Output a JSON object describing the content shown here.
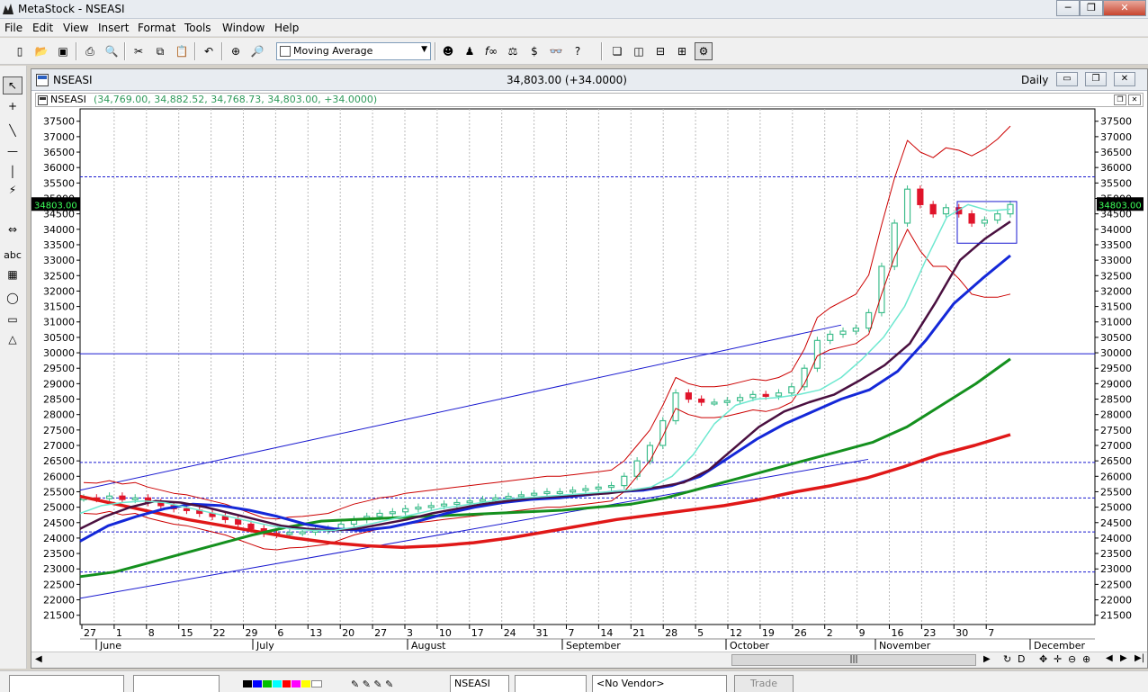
{
  "window": {
    "title": "MetaStock - NSEASI"
  },
  "menu": [
    "File",
    "Edit",
    "View",
    "Insert",
    "Format",
    "Tools",
    "Window",
    "Help"
  ],
  "toolbar": {
    "indicator_select": "Moving Average"
  },
  "chart_window": {
    "symbol": "NSEASI",
    "price_summary": "34,803.00 (+34.0000)",
    "periodicity": "Daily",
    "pane_title_symbol": "NSEASI",
    "pane_title_ohlc": "(34,769.00, 34,882.52, 34,768.73, 34,803.00, +34.0000)",
    "last_price_tag": "34803.00"
  },
  "statusbar": {
    "symbol": "NSEASI",
    "vendor": "<No Vendor>",
    "trade": "Trade"
  },
  "colors": {
    "up_candle": "#3ebd8c",
    "down_candle": "#e0142a",
    "ma_light": "#6ee8d0",
    "ma_maroon": "#4a1040",
    "ma_blue": "#1428d8",
    "ma_green": "#14901e",
    "ma_red": "#e01818",
    "band": "#cc0000",
    "line": "#1a1ad0"
  },
  "chart_data": {
    "type": "candlestick",
    "y_ticks": [
      21500,
      22000,
      22500,
      23000,
      23500,
      24000,
      24500,
      25000,
      25500,
      26000,
      26500,
      27000,
      27500,
      28000,
      28500,
      29000,
      29500,
      30000,
      30500,
      31000,
      31500,
      32000,
      32500,
      33000,
      33500,
      34000,
      34500,
      35000,
      35500,
      36000,
      36500,
      37000,
      37500
    ],
    "ylim": [
      21200,
      37900
    ],
    "x_day_labels": [
      "27",
      "1",
      "8",
      "15",
      "22",
      "29",
      "6",
      "13",
      "20",
      "27",
      "3",
      "10",
      "17",
      "24",
      "31",
      "7",
      "14",
      "21",
      "28",
      "5",
      "12",
      "19",
      "26",
      "2",
      "9",
      "16",
      "23",
      "30",
      "7"
    ],
    "x_month_labels": [
      "June",
      "July",
      "August",
      "September",
      "October",
      "November",
      "December"
    ],
    "horizontal_lines": [
      35700,
      29970,
      26450,
      25300,
      24200,
      22900
    ],
    "solid_horizontal": 29970,
    "close_series": [
      25300,
      25280,
      25360,
      25250,
      25300,
      25150,
      25050,
      24950,
      24900,
      24800,
      24700,
      24600,
      24450,
      24300,
      24150,
      24120,
      24180,
      24200,
      24250,
      24300,
      24450,
      24600,
      24700,
      24800,
      24850,
      24950,
      25000,
      25050,
      25100,
      25150,
      25200,
      25250,
      25300,
      25350,
      25400,
      25450,
      25500,
      25500,
      25550,
      25600,
      25650,
      25700,
      26000,
      26500,
      27000,
      27800,
      28700,
      28500,
      28400,
      28400,
      28450,
      28550,
      28650,
      28600,
      28700,
      28900,
      29500,
      30400,
      30600,
      30700,
      30800,
      31300,
      32800,
      34200,
      35300,
      34800,
      34500,
      34700,
      34500,
      34200,
      34300,
      34500,
      34803
    ],
    "ma_light": [
      24800,
      25050,
      25150,
      25200,
      25150,
      25000,
      24850,
      24700,
      24550,
      24400,
      24300,
      24250,
      24250,
      24350,
      24500,
      24650,
      24800,
      24950,
      25050,
      25150,
      25250,
      25300,
      25350,
      25400,
      25450,
      25500,
      25550,
      25650,
      26000,
      26700,
      27700,
      28300,
      28500,
      28550,
      28650,
      28800,
      29200,
      29800,
      30500,
      31500,
      33000,
      34400,
      34800,
      34600,
      34650
    ],
    "ma_maroon": [
      24300,
      24700,
      25000,
      25200,
      25150,
      25000,
      24800,
      24600,
      24400,
      24300,
      24250,
      24300,
      24450,
      24600,
      24800,
      24950,
      25100,
      25200,
      25300,
      25350,
      25400,
      25450,
      25550,
      25650,
      25800,
      26200,
      26900,
      27600,
      28100,
      28400,
      28650,
      29100,
      29600,
      30300,
      31600,
      33000,
      33700,
      34250
    ],
    "ma_blue": [
      23900,
      24400,
      24700,
      24950,
      25100,
      25050,
      24900,
      24700,
      24450,
      24300,
      24250,
      24350,
      24550,
      24800,
      25000,
      25150,
      25250,
      25300,
      25400,
      25500,
      25550,
      25700,
      26000,
      26600,
      27200,
      27700,
      28100,
      28500,
      28800,
      29400,
      30400,
      31600,
      32400,
      33150
    ],
    "ma_green": [
      22750,
      22900,
      23200,
      23500,
      23800,
      24100,
      24350,
      24550,
      24600,
      24650,
      24700,
      24750,
      24800,
      24850,
      24900,
      25000,
      25100,
      25300,
      25600,
      25900,
      26200,
      26500,
      26800,
      27100,
      27600,
      28300,
      29000,
      29800
    ],
    "ma_red": [
      25350,
      25100,
      24850,
      24600,
      24400,
      24200,
      24000,
      23850,
      23750,
      23700,
      23750,
      23850,
      24000,
      24200,
      24400,
      24600,
      24750,
      24900,
      25050,
      25250,
      25500,
      25700,
      25950,
      26300,
      26700,
      27000,
      27350
    ]
  }
}
